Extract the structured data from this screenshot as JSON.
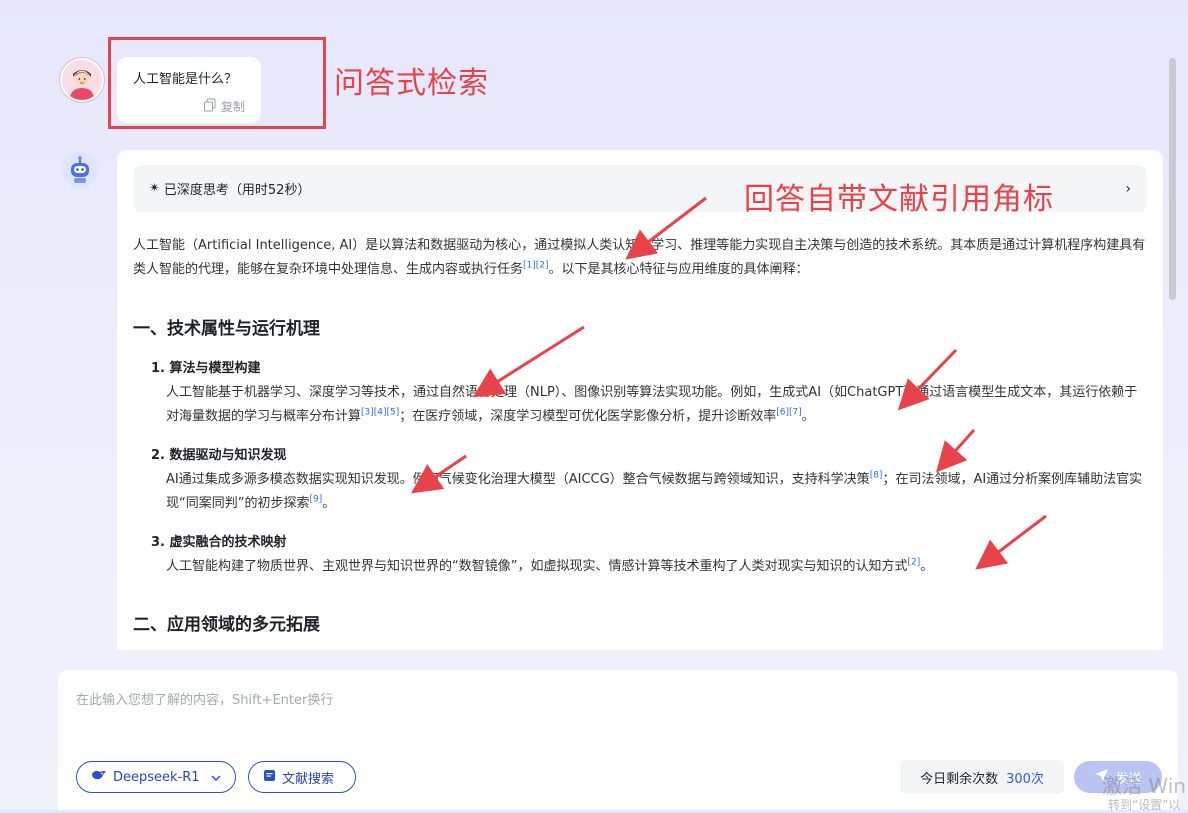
{
  "question": {
    "text": "人工智能是什么？",
    "copy_label": "复制"
  },
  "annotations": {
    "box_label": "问答式检索",
    "arrow_label": "回答自带文献引用角标"
  },
  "answer": {
    "thinking_label": "已深度思考（用时52秒）",
    "intro": {
      "p1": "人工智能（Artificial Intelligence, AI）是以算法和数据驱动为核心，通过模拟人类认知、学习、推理等能力实现自主决策与创造的技术系统。其本质是通过计算机程序构建具有类人智能的代理，能够在复杂环境中处理信息、生成内容或执行任务",
      "c1": "[1][2]",
      "p2": "。以下是其核心特征与应用维度的具体阐释："
    },
    "section1_title": "一、技术属性与运行机理",
    "items": [
      {
        "title": "1. 算法与模型构建",
        "p1": "人工智能基于机器学习、深度学习等技术，通过自然语言处理（NLP）、图像识别等算法实现功能。例如，生成式AI（如ChatGPT）通过语言模型生成文本，其运行依赖于对海量数据的学习与概率分布计算",
        "c1": "[3][4][5]",
        "p2": "；在医疗领域，深度学习模型可优化医学影像分析，提升诊断效率",
        "c2": "[6][7]",
        "p3": "。"
      },
      {
        "title": "2. 数据驱动与知识发现",
        "p1": "AI通过集成多源多模态数据实现知识发现。例如气候变化治理大模型（AICCG）整合气候数据与跨领域知识，支持科学决策",
        "c1": "[8]",
        "p2": "；在司法领域，AI通过分析案例库辅助法官实现“同案同判”的初步探索",
        "c2": "[9]",
        "p3": "。"
      },
      {
        "title": "3. 虚实融合的技术映射",
        "p1": "人工智能构建了物质世界、主观世界与知识世界的“数智镜像”，如虚拟现实、情感计算等技术重构了人类对现实与知识的认知方式",
        "c1": "[2]",
        "p2": "。"
      }
    ],
    "section2_title": "二、应用领域的多元拓展"
  },
  "input": {
    "placeholder": "在此输入您想了解的内容，Shift+Enter换行",
    "model_label": "Deepseek-R1",
    "lit_search_label": "文献搜索",
    "quota_label": "今日剩余次数",
    "quota_value": "300次",
    "send_label": "发送"
  },
  "watermark": {
    "line1": "激活 Win",
    "line2": "转到“设置”以"
  },
  "colors": {
    "accent": "#2d4fcf",
    "annotation": "#e8424a",
    "citation": "#2d6cdf"
  }
}
